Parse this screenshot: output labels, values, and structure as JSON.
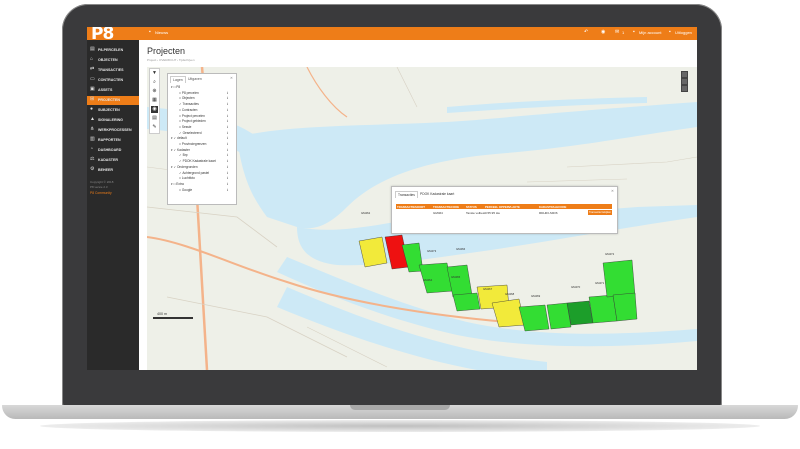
{
  "app": {
    "logo_text": "P8",
    "brand_color": "#ee7d18",
    "sidebar_color": "#2a2a2a"
  },
  "topbar": {
    "news_label": "Nieuws",
    "account_label": "Mijn account",
    "logout_label": "Uitloggen",
    "mail_count": "1"
  },
  "sidebar": {
    "items": [
      {
        "label": "P8-PERCELEN",
        "icon": "map-icon"
      },
      {
        "label": "OBJECTEN",
        "icon": "home-icon"
      },
      {
        "label": "TRANSACTIES",
        "icon": "exchange-icon"
      },
      {
        "label": "CONTRACTEN",
        "icon": "document-icon"
      },
      {
        "label": "ASSETS",
        "icon": "box-icon"
      },
      {
        "label": "PROJECTEN",
        "icon": "sitemap-icon"
      },
      {
        "label": "SUBJECTEN",
        "icon": "users-icon"
      },
      {
        "label": "SIGNALERING",
        "icon": "bell-icon"
      },
      {
        "label": "WERKPROCESSEN",
        "icon": "workflow-icon"
      },
      {
        "label": "RAPPORTEN",
        "icon": "report-icon"
      },
      {
        "label": "DASHBOARD",
        "icon": "dashboard-icon"
      },
      {
        "label": "KADASTER",
        "icon": "kadaster-icon"
      },
      {
        "label": "BEHEER",
        "icon": "settings-icon"
      }
    ],
    "active_index": 5,
    "footer_line1": "Copyright © 2018",
    "footer_line2": "P8 versie 2.3",
    "footer_link": "P8 Community"
  },
  "page": {
    "title": "Projecten",
    "breadcrumb": [
      "Project",
      "OVERZICHT",
      "Tijdschijven"
    ]
  },
  "legend": {
    "tabs": [
      "Lagen",
      "Uitgaven"
    ],
    "active_tab": 0,
    "rows": [
      {
        "label": "P8",
        "level": 0,
        "checked": false,
        "group": true
      },
      {
        "label": "P8 percelen",
        "level": 2,
        "checked": false
      },
      {
        "label": "Objecten",
        "level": 2,
        "checked": false
      },
      {
        "label": "Transacties",
        "level": 2,
        "checked": true
      },
      {
        "label": "Contracten",
        "level": 2,
        "checked": false
      },
      {
        "label": "Project percelen",
        "level": 2,
        "checked": false
      },
      {
        "label": "Project gebieden",
        "level": 2,
        "checked": false
      },
      {
        "label": "Sessie",
        "level": 2,
        "checked": false
      },
      {
        "label": "Geselecteerd",
        "level": 2,
        "checked": true
      },
      {
        "label": "default",
        "level": 0,
        "checked": true,
        "group": true
      },
      {
        "label": "Provinciegrenzen",
        "level": 2,
        "checked": false
      },
      {
        "label": "Kadaster",
        "level": 0,
        "checked": true,
        "group": true
      },
      {
        "label": "Brp",
        "level": 2,
        "checked": true
      },
      {
        "label": "PDOK Kadastrale kaart",
        "level": 2,
        "checked": true
      },
      {
        "label": "Ondergronden",
        "level": 0,
        "checked": true,
        "group": true
      },
      {
        "label": "Achtergrond pastel",
        "level": 2,
        "checked": true
      },
      {
        "label": "Luchtfoto",
        "level": 2,
        "checked": false
      },
      {
        "label": "Extra",
        "level": 0,
        "checked": false,
        "group": true
      },
      {
        "label": "Google",
        "level": 2,
        "checked": false
      }
    ]
  },
  "popup": {
    "tabs": [
      "Transacties",
      "PDOK Kadastrale kaart"
    ],
    "columns": [
      "TRANSACTIESOORT",
      "TRANSACTIECODE",
      "STATUS",
      "PERCEEL OPPERVLAKTE",
      "KADASTRALECODE"
    ],
    "row": [
      "",
      "GM464",
      "Tanste volbest",
      "0.55.95 Ha",
      "RDH03-S9O6"
    ],
    "button_label": "Transactie bekijken"
  },
  "map": {
    "scale_label": "400 m",
    "parcel_labels": [
      "GM462",
      "GM463",
      "GM464",
      "GM465",
      "GM466",
      "GM467",
      "GM468",
      "GM469",
      "GM470",
      "GM471",
      "GM472",
      "GM473"
    ],
    "colors": {
      "water": "#cde9f6",
      "land": "#eef0e8",
      "road_major": "#f4b38a",
      "road_minor": "#ffffff",
      "parcel_green": "#33dd33",
      "parcel_yellow": "#f2ea3a",
      "parcel_red": "#ee1111",
      "parcel_dark": "#1c9e2a"
    }
  }
}
